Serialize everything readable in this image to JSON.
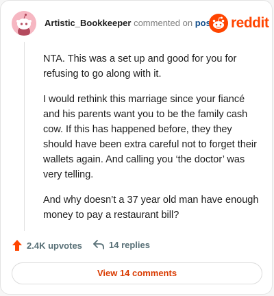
{
  "header": {
    "username": "Artistic_Bookkeeper",
    "commented_text": "commented on",
    "post_link": "post",
    "brand": "reddit"
  },
  "comment": {
    "paragraphs": [
      "NTA. This was a set up and good for you for refusing to go along with it.",
      "I would rethink this marriage since your fiancé and his parents want you to be the family cash cow. If this has happened before, they they should have been extra careful not to forget their wallets again. And calling you ‘the doctor’ was very telling.",
      "And why doesn’t a 37 year old man have enough money to pay a restaurant bill?"
    ]
  },
  "actions": {
    "upvotes": "2.4K upvotes",
    "replies": "14 replies"
  },
  "view_button": "View 14 comments",
  "colors": {
    "brand": "#ff4500",
    "upvote": "#ff4500",
    "link": "#0f4c8a",
    "view_button_text": "#d93a00",
    "avatar_bg": "#f6b7c2"
  },
  "icons": [
    "snoo-avatar-icon",
    "reddit-logo-icon",
    "upvote-arrow-icon",
    "reply-arrow-icon"
  ]
}
